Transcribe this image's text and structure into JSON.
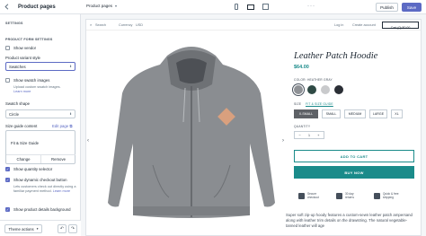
{
  "topbar": {
    "back_icon": "back-arrow-icon",
    "title": "Product pages",
    "page_selector": "Product pages",
    "devices": [
      "mobile-icon",
      "desktop-icon",
      "fullscreen-icon"
    ],
    "more_label": "···",
    "publish_label": "Publish",
    "save_label": "Save"
  },
  "sidebar": {
    "settings_heading": "SETTINGS",
    "form_heading": "PRODUCT FORM SETTINGS",
    "show_vendor": {
      "label": "Show vendor",
      "checked": false
    },
    "variant_style_label": "Product variant style",
    "variant_style_value": "Swatches",
    "show_swatch_images": {
      "label": "Show swatch images",
      "checked": false
    },
    "swatch_help": "Upload custom swatch images.",
    "swatch_help_link": "Learn more",
    "swatch_shape_label": "Swatch shape",
    "swatch_shape_value": "Circle",
    "size_guide_label": "Size guide content",
    "edit_page_link": "Edit page",
    "size_guide_value": "Fit & Size Guide",
    "change_label": "Change",
    "remove_label": "Remove",
    "show_quantity": {
      "label": "Show quantity selector",
      "checked": true
    },
    "show_dynamic": {
      "label": "Show dynamic checkout button",
      "checked": true
    },
    "dynamic_help": "Lets customers check out directly using a familiar payment method.",
    "dynamic_help_link": "Learn more",
    "show_details_bg": {
      "label": "Show product details background",
      "checked": true
    },
    "theme_actions_label": "Theme actions",
    "undo_icon": "undo-icon",
    "redo_icon": "redo-icon"
  },
  "preview": {
    "search_label": "Search",
    "currency_label": "Currency",
    "currency_value": "USD",
    "login_label": "Log in",
    "create_account_label": "Create account",
    "cart_label": "Cart (0) $0.00",
    "product_title": "Leather Patch Hoodie",
    "price": "$64.00",
    "color_label": "COLOR: HEATHER GRAY",
    "swatch_colors": [
      "#8f9296",
      "#2f4a45",
      "#c9cacc",
      "#2b2f36"
    ],
    "size_label": "SIZE",
    "size_guide_link": "FIT & SIZE GUIDE",
    "sizes": [
      "X-SMALL",
      "SMALL",
      "MEDIUM",
      "LARGE",
      "XL"
    ],
    "selected_size": "X-SMALL",
    "quantity_label": "QUANTITY",
    "quantity_value": "1",
    "add_to_cart": "ADD TO CART",
    "buy_now": "BUY NOW",
    "features": [
      {
        "icon": "lock-icon",
        "text": "Secure checkout"
      },
      {
        "icon": "return-box-icon",
        "text": "30 day returns"
      },
      {
        "icon": "shipping-truck-icon",
        "text": "Quick & free shipping"
      }
    ],
    "description": "Super soft zip-up hoody features a custom-sewn leather patch ampersand along with leather trim details on the drawstring. The natural vegetable-tanned leather will age"
  },
  "colors": {
    "accent": "#5c6ac4",
    "brand_teal": "#1a8b8a"
  }
}
